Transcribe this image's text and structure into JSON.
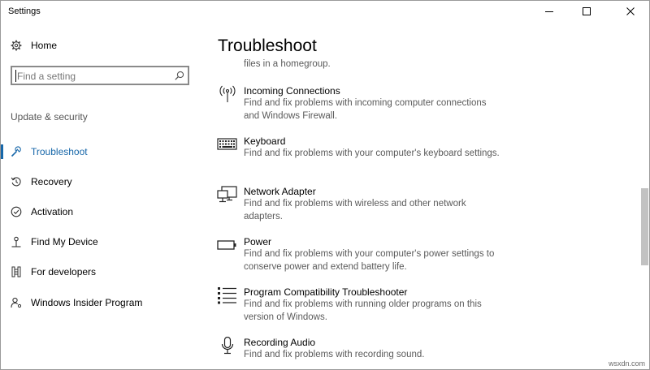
{
  "window": {
    "title": "Settings"
  },
  "sidebar": {
    "home_label": "Home",
    "search_placeholder": "Find a setting",
    "section_title": "Update & security",
    "items": [
      {
        "label": "Troubleshoot",
        "icon": "wrench-icon",
        "active": true
      },
      {
        "label": "Recovery",
        "icon": "recovery-icon",
        "active": false
      },
      {
        "label": "Activation",
        "icon": "activation-check-icon",
        "active": false
      },
      {
        "label": "Find My Device",
        "icon": "find-device-icon",
        "active": false
      },
      {
        "label": "For developers",
        "icon": "developers-icon",
        "active": false
      },
      {
        "label": "Windows Insider Program",
        "icon": "insider-icon",
        "active": false
      }
    ]
  },
  "main": {
    "title": "Troubleshoot",
    "cut_off_description": "files in a homegroup.",
    "troubleshooters": [
      {
        "title": "Incoming Connections",
        "description": "Find and fix problems with incoming computer connections and Windows Firewall.",
        "icon": "antenna-icon"
      },
      {
        "title": "Keyboard",
        "description": "Find and fix problems with your computer's keyboard settings.",
        "icon": "keyboard-icon"
      },
      {
        "title": "Network Adapter",
        "description": "Find and fix problems with wireless and other network adapters.",
        "icon": "network-adapter-icon"
      },
      {
        "title": "Power",
        "description": "Find and fix problems with your computer's power settings to conserve power and extend battery life.",
        "icon": "battery-icon"
      },
      {
        "title": "Program Compatibility Troubleshooter",
        "description": "Find and fix problems with running older programs on this version of Windows.",
        "icon": "program-list-icon"
      },
      {
        "title": "Recording Audio",
        "description": "Find and fix problems with recording sound.",
        "icon": "microphone-icon"
      }
    ]
  },
  "watermark": "wsxdn.com",
  "colors": {
    "accent": "#1767a9",
    "secondary_text": "#5a5a5a",
    "scroll_thumb": "#c2c2c2"
  }
}
